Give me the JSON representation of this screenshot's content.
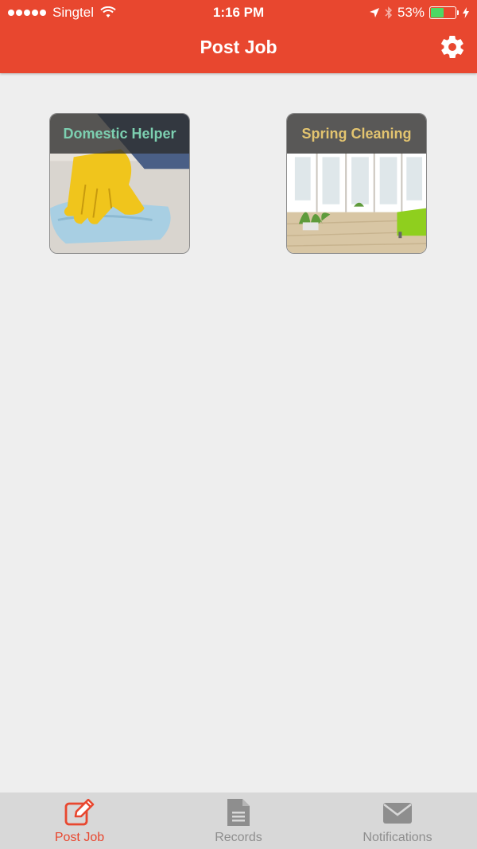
{
  "status_bar": {
    "carrier": "Singtel",
    "time": "1:16 PM",
    "battery_percent": "53%",
    "battery_level": 0.53
  },
  "header": {
    "title": "Post Job",
    "settings_icon": "gear-icon",
    "bg_color": "#e8472f"
  },
  "tiles": [
    {
      "label": "Domestic Helper",
      "label_color": "#7ccfb0",
      "image": "gloved-hand-cleaning-floor"
    },
    {
      "label": "Spring Cleaning",
      "label_color": "#e3c46f",
      "image": "bright-living-room"
    }
  ],
  "tabs": [
    {
      "label": "Post Job",
      "icon": "edit-icon",
      "active": true
    },
    {
      "label": "Records",
      "icon": "document-icon",
      "active": false
    },
    {
      "label": "Notifications",
      "icon": "envelope-icon",
      "active": false
    }
  ],
  "colors": {
    "accent": "#e8472f",
    "tab_inactive": "#8e8e8e",
    "background": "#eeeeee"
  }
}
